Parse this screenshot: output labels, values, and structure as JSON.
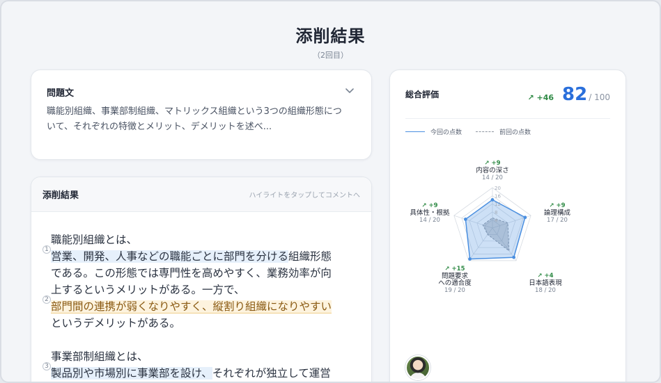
{
  "header": {
    "title": "添削結果",
    "subtitle": "（2回目）"
  },
  "question": {
    "label": "問題文",
    "text": "職能別組織、事業部制組織、マトリックス組織という3つの組織形態について、それぞれの特徴とメリット、デメリットを述べ..."
  },
  "result": {
    "title": "添削結果",
    "hint": "ハイライトをタップしてコメントへ",
    "lines": {
      "l1": "職能別組織とは、",
      "l2_hl": "営業、開発、人事などの職能ごとに部門を分ける",
      "l2_rest": "組織形態",
      "l3": "である。この形態では専門性を高めやすく、業務効率が向",
      "l4": "上するというメリットがある。一方で、",
      "l5_hl": "部門間の連携が弱くなりやすく、縦割り組織になりやすい",
      "l6": "というデメリットがある。",
      "l7": "事業部制組織とは、",
      "l8_hl": "製品別や市場別に事業部を設け、",
      "l8_rest": "それぞれが独立して運営"
    },
    "markers": [
      "1",
      "2",
      "3"
    ]
  },
  "score": {
    "label": "総合評価",
    "delta": "↗ +46",
    "value": "82",
    "max": "/ 100",
    "legend_current": "今回の点数",
    "legend_previous": "前回の点数",
    "accent": "#2a6fdb",
    "delta_color": "#2f8a45"
  },
  "chart_data": {
    "type": "radar",
    "axes": [
      {
        "label": "内容の深さ",
        "current": 14,
        "previous": 5,
        "delta": "↗ +9",
        "score_text": "14 / 20"
      },
      {
        "label": "論理構成",
        "current": 17,
        "previous": 8,
        "delta": "↗ +9",
        "score_text": "17 / 20"
      },
      {
        "label": "日本語表現",
        "current": 18,
        "previous": 14,
        "delta": "↗ +4",
        "score_text": "18 / 20"
      },
      {
        "label": "問題要求への適合度",
        "label_lines": [
          "問題要求",
          "への適合度"
        ],
        "current": 19,
        "previous": 4,
        "delta": "↗ +15",
        "score_text": "19 / 20"
      },
      {
        "label": "具体性・根拠",
        "current": 14,
        "previous": 5,
        "delta": "↗ +9",
        "score_text": "14 / 20"
      }
    ],
    "ticks": [
      "4",
      "8",
      "12",
      "16",
      "20"
    ],
    "max": 20,
    "current_color": "#4a8fe0",
    "previous_color": "#8d95a1"
  }
}
